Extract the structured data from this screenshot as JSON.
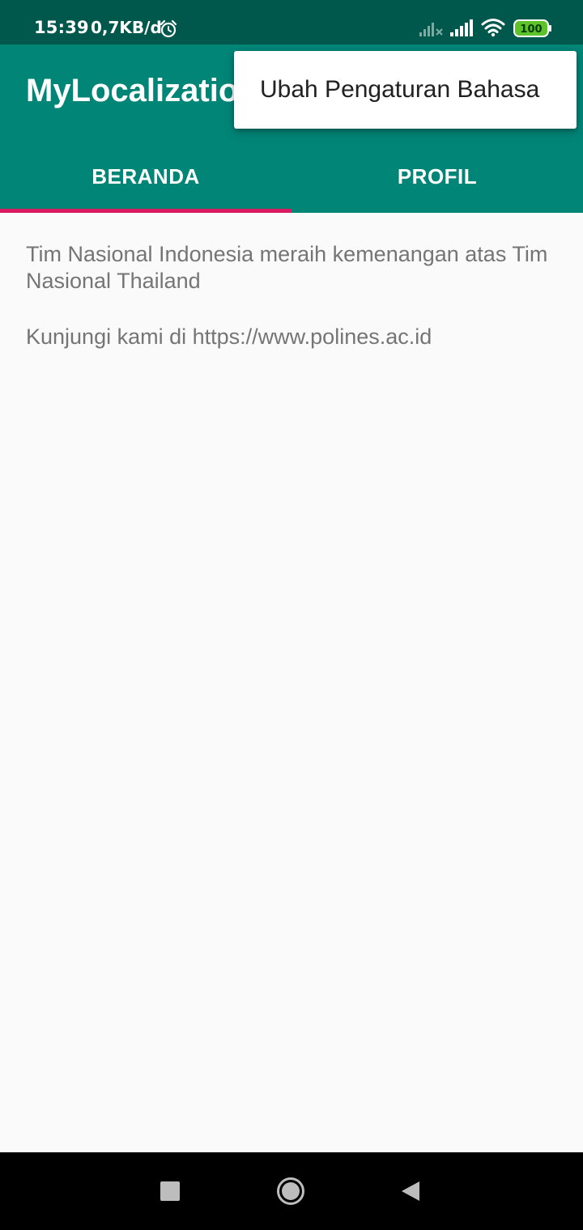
{
  "status_bar": {
    "time": "15:39",
    "network_speed": "0,7KB/d",
    "battery_level": "100",
    "icons": [
      "alarm-icon",
      "signal-x-icon",
      "signal-icon",
      "wifi-icon",
      "battery-icon"
    ]
  },
  "app_bar": {
    "title": "MyLocalization"
  },
  "tabs": [
    {
      "label": "BERANDA",
      "selected": true
    },
    {
      "label": "PROFIL",
      "selected": false
    }
  ],
  "content": {
    "headline": "Tim Nasional Indonesia meraih kemenangan atas Tim Nasional Thailand",
    "visit": "Kunjungi kami di https://www.polines.ac.id"
  },
  "popup_menu": {
    "items": [
      {
        "label": "Ubah Pengaturan Bahasa"
      }
    ]
  },
  "nav_bar": {
    "icons": [
      "recents-icon",
      "home-icon",
      "back-icon"
    ]
  },
  "colors": {
    "status_bar": "#00574b",
    "primary": "#008577",
    "accent": "#d81b60",
    "content_text": "#757575",
    "background": "#fafafa"
  }
}
